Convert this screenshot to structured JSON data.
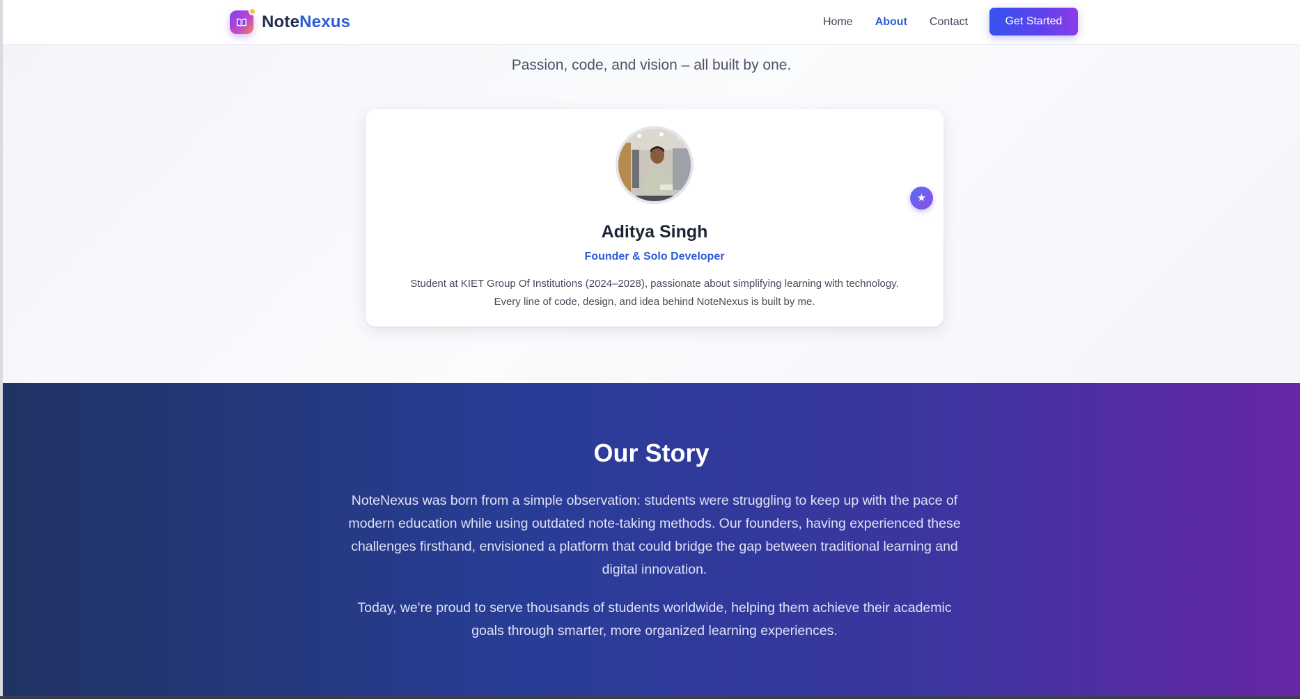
{
  "brand": {
    "name_part1": "Note",
    "name_part2": "Nexus"
  },
  "nav": {
    "links": [
      {
        "label": "Home",
        "active": false
      },
      {
        "label": "About",
        "active": true
      },
      {
        "label": "Contact",
        "active": false
      }
    ],
    "cta_label": "Get Started"
  },
  "hero": {
    "subtitle": "Passion, code, and vision – all built by one."
  },
  "profile": {
    "name": "Aditya Singh",
    "role": "Founder & Solo Developer",
    "bio_line1": "Student at KIET Group Of Institutions (2024–2028), passionate about simplifying learning with technology.",
    "bio_line2": "Every line of code, design, and idea behind NoteNexus is built by me.",
    "badge_icon": "star-icon"
  },
  "story": {
    "title": "Our Story",
    "paragraph1": "NoteNexus was born from a simple observation: students were struggling to keep up with the pace of modern education while using outdated note-taking methods. Our founders, having experienced these challenges firsthand, envisioned a platform that could bridge the gap between traditional learning and digital innovation.",
    "paragraph2": "Today, we're proud to serve thousands of students worldwide, helping them achieve their academic goals through smarter, more organized learning experiences."
  },
  "colors": {
    "accent_blue": "#2e5bd8",
    "cta_gradient_start": "#3553f0",
    "cta_gradient_end": "#8b3ce9",
    "story_gradient_start": "#213364",
    "story_gradient_end": "#6626a6"
  }
}
